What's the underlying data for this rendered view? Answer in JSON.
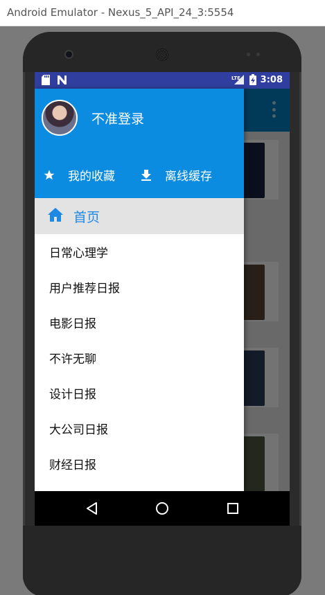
{
  "window": {
    "title": "Android Emulator - Nexus_5_API_24_3:5554"
  },
  "status_bar": {
    "time": "3:08",
    "network": "LTE"
  },
  "drawer": {
    "username": "不准登录",
    "actions": [
      {
        "label": "我的收藏",
        "icon": "star-icon"
      },
      {
        "label": "离线缓存",
        "icon": "download-icon"
      }
    ],
    "home": {
      "label": "首页",
      "icon": "home-icon"
    },
    "items": [
      "日常心理学",
      "用户推荐日报",
      "电影日报",
      "不许无聊",
      "设计日报",
      "大公司日报",
      "财经日报"
    ]
  },
  "colors": {
    "status_bar": "#303f9f",
    "toolbar": "#0081c4",
    "drawer_header": "#0c8ce0",
    "accent": "#1e88e5",
    "selected_bg": "#e3e3e3"
  },
  "nav_bar": {
    "back_icon": "back-triangle-icon",
    "home_icon": "home-circle-icon",
    "recents_icon": "recents-square-icon"
  }
}
